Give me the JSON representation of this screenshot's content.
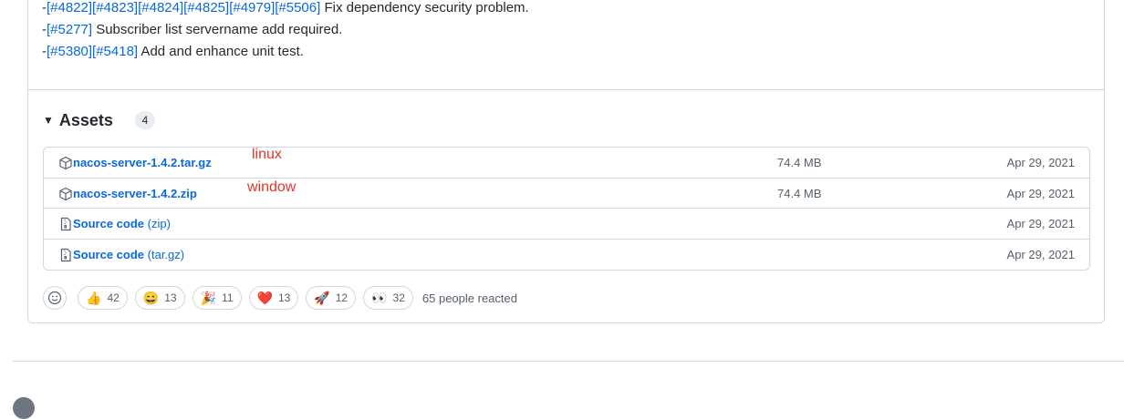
{
  "notes": {
    "lines": [
      {
        "prefix": "-",
        "links": [
          "[#4822]",
          "[#4823]",
          "[#4824]",
          "[#4825]",
          "[#4979]",
          "[#5506]"
        ],
        "text": " Fix dependency security problem."
      },
      {
        "prefix": "-",
        "links": [
          "[#5277]"
        ],
        "text": " Subscriber list servername add required."
      },
      {
        "prefix": "-",
        "links": [
          "[#5380]",
          "[#5418]"
        ],
        "text": " Add and enhance unit test."
      }
    ]
  },
  "assets": {
    "title": "Assets",
    "count": "4",
    "rows": [
      {
        "icon": "package-icon",
        "name": "nacos-server-1.4.2.tar.gz",
        "suffix": "",
        "size": "74.4 MB",
        "date": "Apr 29, 2021"
      },
      {
        "icon": "package-icon",
        "name": "nacos-server-1.4.2.zip",
        "suffix": "",
        "size": "74.4 MB",
        "date": "Apr 29, 2021"
      },
      {
        "icon": "file-zip-icon",
        "name": "Source code",
        "suffix": " (zip)",
        "size": "",
        "date": "Apr 29, 2021"
      },
      {
        "icon": "file-zip-icon",
        "name": "Source code",
        "suffix": " (tar.gz)",
        "size": "",
        "date": "Apr 29, 2021"
      }
    ]
  },
  "annotations": {
    "linux": "linux",
    "window": "window"
  },
  "reactions": {
    "items": [
      {
        "name": "thumbs-up",
        "emoji": "👍",
        "count": "42"
      },
      {
        "name": "laugh",
        "emoji": "😄",
        "count": "13"
      },
      {
        "name": "hooray",
        "emoji": "🎉",
        "count": "11"
      },
      {
        "name": "heart",
        "emoji": "❤️",
        "count": "13"
      },
      {
        "name": "rocket",
        "emoji": "🚀",
        "count": "12"
      },
      {
        "name": "eyes",
        "emoji": "👀",
        "count": "32"
      }
    ],
    "summary": "65 people reacted"
  }
}
